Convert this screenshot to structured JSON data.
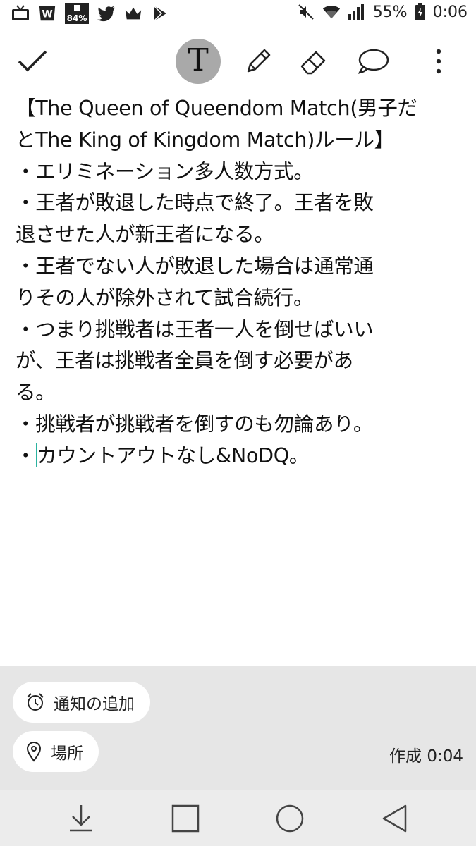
{
  "status_bar": {
    "battery_level": "55%",
    "time": "0:06",
    "app_badge": "84%",
    "icons": [
      "tv-icon",
      "w-logo-icon",
      "percent-badge-icon",
      "twitter-icon",
      "crown-icon",
      "play-store-icon",
      "mute-icon",
      "wifi-icon",
      "signal-icon",
      "battery-icon"
    ]
  },
  "toolbar": {
    "text_tool_glyph": "T",
    "active_tool": "text",
    "tools": [
      "check-icon",
      "text-tool",
      "pen-icon",
      "eraser-icon",
      "speech-bubble-icon",
      "more-vert-icon"
    ]
  },
  "note": {
    "lines": [
      "【The Queen of Queendom Match(男子だ",
      "とThe King of Kingdom Match)ルール】",
      "・エリミネーション多人数方式。",
      "・王者が敗退した時点で終了。王者を敗",
      "退させた人が新王者になる。",
      "・王者でない人が敗退した場合は通常通",
      "りその人が除外されて試合続行。",
      "・つまり挑戦者は王者一人を倒せばいい",
      "が、王者は挑戦者全員を倒す必要があ",
      "る。",
      "・挑戦者が挑戦者を倒すのも勿論あり。"
    ],
    "last_line_prefix": "・",
    "last_line_rest": "カウントアウトなし&NoDQ。",
    "cursor_color": "#2bb3a0"
  },
  "panel": {
    "notify_label": "通知の追加",
    "place_label": "場所",
    "created_label": "作成 0:04"
  },
  "nav": {
    "buttons": [
      "download-icon",
      "recent-apps-icon",
      "home-icon",
      "back-icon"
    ]
  }
}
